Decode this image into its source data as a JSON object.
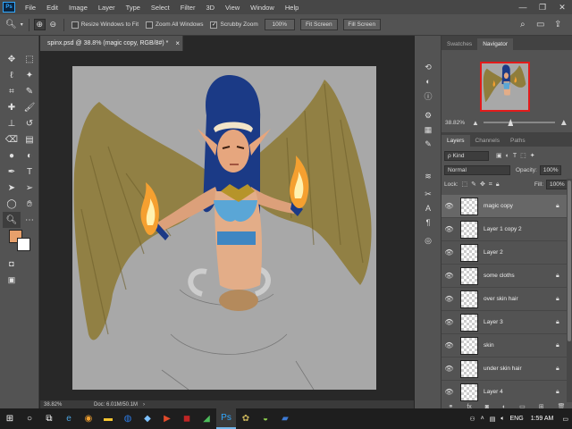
{
  "app": {
    "logo": "Ps",
    "menu": [
      "File",
      "Edit",
      "Image",
      "Layer",
      "Type",
      "Select",
      "Filter",
      "3D",
      "View",
      "Window",
      "Help"
    ],
    "window_controls": [
      "—",
      "❐",
      "✕"
    ]
  },
  "options_bar": {
    "resize_windows_label": "Resize Windows to Fit",
    "resize_windows_checked": false,
    "zoom_all_label": "Zoom All Windows",
    "zoom_all_checked": false,
    "scrubby_zoom_label": "Scrubby Zoom",
    "scrubby_zoom_checked": true,
    "zoom_value": "100%",
    "fit_screen_label": "Fit Screen",
    "fill_screen_label": "Fill Screen"
  },
  "document": {
    "tab_title": "spinx.psd @ 38.8% (magic copy, RGB/8#) *",
    "tab_close": "×",
    "status_zoom": "38.82%",
    "status_doc": "Doc: 6.01M/50.1M",
    "status_arrow": "›"
  },
  "navigator": {
    "tabs": [
      "Swatches",
      "Navigator"
    ],
    "active_tab": "Navigator",
    "zoom_value": "38.82%",
    "zoom_level": 0.38
  },
  "layers_panel": {
    "tabs": [
      "Layers",
      "Channels",
      "Paths"
    ],
    "active_tab": "Layers",
    "filter_kind": "ρ Kind",
    "blend_mode": "Normal",
    "opacity_label": "Opacity:",
    "opacity_value": "100%",
    "lock_label": "Lock:",
    "fill_label": "Fill:",
    "fill_value": "100%",
    "layers": [
      {
        "name": "magic copy",
        "selected": true,
        "locked": true
      },
      {
        "name": "Layer 1 copy 2",
        "selected": false,
        "locked": false
      },
      {
        "name": "Layer 2",
        "selected": false,
        "locked": false
      },
      {
        "name": "some cloths",
        "selected": false,
        "locked": true
      },
      {
        "name": "over skin hair",
        "selected": false,
        "locked": true
      },
      {
        "name": "Layer 3",
        "selected": false,
        "locked": true
      },
      {
        "name": "skin",
        "selected": false,
        "locked": true
      },
      {
        "name": "under skin hair",
        "selected": false,
        "locked": true
      },
      {
        "name": "Layer 4",
        "selected": false,
        "locked": true
      }
    ],
    "bottom_icons": [
      "link-icon",
      "fx-icon",
      "mask-icon",
      "adjustment-icon",
      "group-icon",
      "new-layer-icon",
      "trash-icon"
    ]
  },
  "taskbar": {
    "time": "1:59 AM",
    "language": "ENG",
    "active_app": "photoshop"
  },
  "colors": {
    "foreground": "#e7a06b",
    "background": "#ffffff",
    "canvas_bg": "#a8a8a8",
    "wing": "#8f7d3c",
    "hair": "#1b3a86"
  }
}
